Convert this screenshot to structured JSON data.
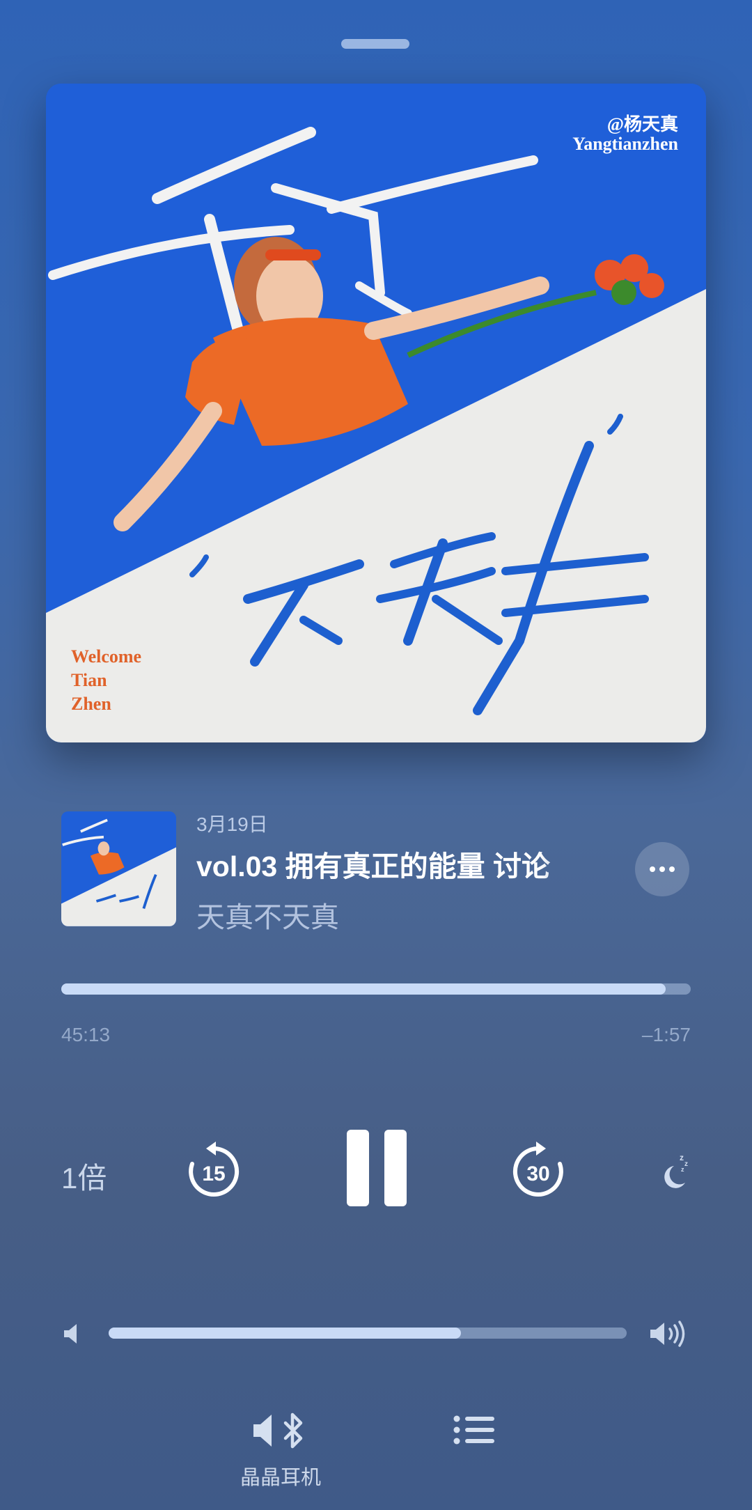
{
  "album_cover": {
    "handle": "@杨天真",
    "subtitle": "Yangtianzhen",
    "welcome_lines": [
      "Welcome",
      "Tian",
      "Zhen"
    ]
  },
  "track": {
    "date": "3月19日",
    "title": "vol.03 拥有真正的能量 讨论",
    "artist": "天真不天真"
  },
  "playback": {
    "elapsed": "45:13",
    "remaining": "–1:57",
    "progress_fraction": 0.96,
    "speed_label": "1倍",
    "skip_back_seconds": "15",
    "skip_forward_seconds": "30"
  },
  "volume": {
    "level_fraction": 0.68
  },
  "output": {
    "device_label": "晶晶耳机"
  },
  "icons": {
    "more": "ellipsis-icon",
    "sleep": "sleep-timer-moon-icon",
    "device": "speaker-bluetooth-icon",
    "queue": "list-icon"
  },
  "colors": {
    "background_top": "#2f63b6",
    "background_bottom": "#3f5a88",
    "cover_blue": "#1f5fd8",
    "accent_orange": "#e0622a"
  }
}
